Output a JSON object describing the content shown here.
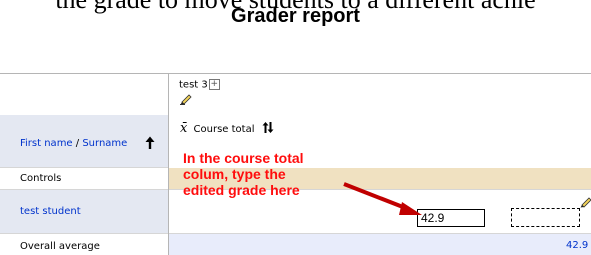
{
  "caption": "the grade to move students to a different achie",
  "report_title": "Grader report",
  "header": {
    "item_name": "test 3",
    "expand_symbol": "+",
    "course_total_symbol": "x̄",
    "course_total_label": "Course total"
  },
  "rows": {
    "firstname_label": "First name",
    "separator": " / ",
    "surname_label": "Surname",
    "controls_label": "Controls",
    "student_name": "test student",
    "overall_average_label": "Overall average"
  },
  "grade": {
    "value": "42.9",
    "average": "42.9"
  },
  "annotation": {
    "lines": [
      "In the course total",
      "colum, type the",
      "edited grade here"
    ]
  },
  "colors": {
    "annotation": "#ff0d0d",
    "arrow": "#c00000",
    "link": "#0033cc",
    "controls_band": "#f0e1c1",
    "average_band": "#e8ecfb"
  },
  "icons": {
    "edit": "pencil-icon",
    "sort_ascending": "up-arrow-icon",
    "sort_toggle": "switch-sort-icon",
    "expand": "plus-box-icon"
  }
}
